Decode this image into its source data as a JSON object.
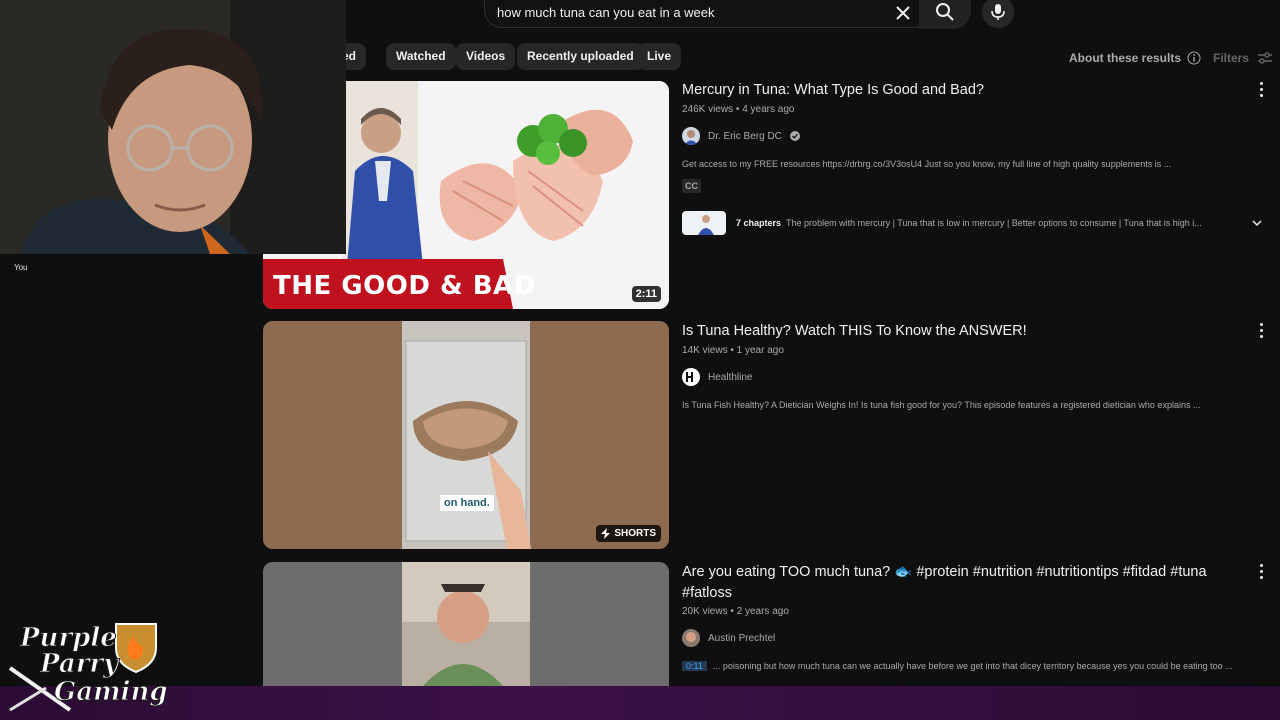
{
  "search": {
    "query": "how much tuna can you eat in a week"
  },
  "chips": [
    "ched",
    "Watched",
    "Videos",
    "Recently uploaded",
    "Live"
  ],
  "toolbar": {
    "about": "About these results",
    "filters": "Filters"
  },
  "webcam": {
    "label": "You"
  },
  "results": [
    {
      "title": "Mercury in Tuna: What Type Is Good and Bad?",
      "views": "246K views",
      "age": "4 years ago",
      "channel": "Dr. Eric Berg DC",
      "description": "Get access to my FREE resources https://drbrg.co/3V3osU4 Just so you know, my full line of high quality supplements is ...",
      "cc": "CC",
      "chapters_count": "7 chapters",
      "chapters_text": "The problem with mercury | Tuna that is low in mercury | Better options to consume | Tuna that is high i...",
      "thumb_caption": "THE GOOD & BAD",
      "duration": "2:11"
    },
    {
      "title": "Is Tuna Healthy? Watch THIS To Know the ANSWER!",
      "views": "14K views",
      "age": "1 year ago",
      "channel": "Healthline",
      "description": "Is Tuna Fish Healthy? A Dietician Weighs In! Is tuna fish good for you? This episode features a registered dietician who explains ...",
      "thumb_caption": "on hand.",
      "badge": "SHORTS"
    },
    {
      "title_line1": "Are you eating TOO much tuna? 🐟 #protein #nutrition #nutritiontips #fitdad #tuna",
      "title_line2": "#fatloss",
      "views": "20K views",
      "age": "2 years ago",
      "channel": "Austin Prechtel",
      "timestamp": "0:11",
      "description": "... poisoning but how much tuna can we actually have before we get into that dicey territory because yes you could be eating too ..."
    }
  ],
  "overlay": {
    "logo_line1": "Purple",
    "logo_line2": "Parry",
    "logo_line3": "Gaming"
  }
}
